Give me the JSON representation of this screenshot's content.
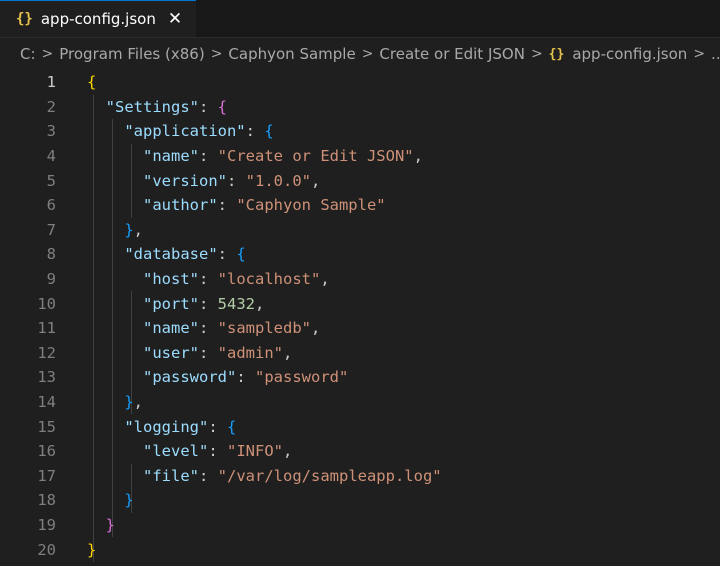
{
  "tab": {
    "icon": "json-braces-icon",
    "title": "app-config.json",
    "close": "✕"
  },
  "breadcrumb": {
    "items": [
      "C:",
      "Program Files (x86)",
      "Caphyon Sample",
      "Create or Edit JSON"
    ],
    "file_icon": "{}",
    "file": "app-config.json",
    "more": "..."
  },
  "editor": {
    "active_line": 1,
    "lines": [
      {
        "n": "1",
        "indent": "",
        "tokens": [
          [
            "b1",
            "{"
          ]
        ]
      },
      {
        "n": "2",
        "indent": "  ",
        "tokens": [
          [
            "k",
            "\"Settings\""
          ],
          [
            "p",
            ": "
          ],
          [
            "b2",
            "{"
          ]
        ]
      },
      {
        "n": "3",
        "indent": "    ",
        "tokens": [
          [
            "k",
            "\"application\""
          ],
          [
            "p",
            ": "
          ],
          [
            "b3",
            "{"
          ]
        ]
      },
      {
        "n": "4",
        "indent": "      ",
        "tokens": [
          [
            "k",
            "\"name\""
          ],
          [
            "p",
            ": "
          ],
          [
            "s",
            "\"Create or Edit JSON\""
          ],
          [
            "p",
            ","
          ]
        ]
      },
      {
        "n": "5",
        "indent": "      ",
        "tokens": [
          [
            "k",
            "\"version\""
          ],
          [
            "p",
            ": "
          ],
          [
            "s",
            "\"1.0.0\""
          ],
          [
            "p",
            ","
          ]
        ]
      },
      {
        "n": "6",
        "indent": "      ",
        "tokens": [
          [
            "k",
            "\"author\""
          ],
          [
            "p",
            ": "
          ],
          [
            "s",
            "\"Caphyon Sample\""
          ]
        ]
      },
      {
        "n": "7",
        "indent": "    ",
        "tokens": [
          [
            "b3",
            "}"
          ],
          [
            "p",
            ","
          ]
        ]
      },
      {
        "n": "8",
        "indent": "    ",
        "tokens": [
          [
            "k",
            "\"database\""
          ],
          [
            "p",
            ": "
          ],
          [
            "b3",
            "{"
          ]
        ]
      },
      {
        "n": "9",
        "indent": "      ",
        "tokens": [
          [
            "k",
            "\"host\""
          ],
          [
            "p",
            ": "
          ],
          [
            "s",
            "\"localhost\""
          ],
          [
            "p",
            ","
          ]
        ]
      },
      {
        "n": "10",
        "indent": "      ",
        "tokens": [
          [
            "k",
            "\"port\""
          ],
          [
            "p",
            ": "
          ],
          [
            "n",
            "5432"
          ],
          [
            "p",
            ","
          ]
        ]
      },
      {
        "n": "11",
        "indent": "      ",
        "tokens": [
          [
            "k",
            "\"name\""
          ],
          [
            "p",
            ": "
          ],
          [
            "s",
            "\"sampledb\""
          ],
          [
            "p",
            ","
          ]
        ]
      },
      {
        "n": "12",
        "indent": "      ",
        "tokens": [
          [
            "k",
            "\"user\""
          ],
          [
            "p",
            ": "
          ],
          [
            "s",
            "\"admin\""
          ],
          [
            "p",
            ","
          ]
        ]
      },
      {
        "n": "13",
        "indent": "      ",
        "tokens": [
          [
            "k",
            "\"password\""
          ],
          [
            "p",
            ": "
          ],
          [
            "s",
            "\"password\""
          ]
        ]
      },
      {
        "n": "14",
        "indent": "    ",
        "tokens": [
          [
            "b3",
            "}"
          ],
          [
            "p",
            ","
          ]
        ]
      },
      {
        "n": "15",
        "indent": "    ",
        "tokens": [
          [
            "k",
            "\"logging\""
          ],
          [
            "p",
            ": "
          ],
          [
            "b3",
            "{"
          ]
        ]
      },
      {
        "n": "16",
        "indent": "      ",
        "tokens": [
          [
            "k",
            "\"level\""
          ],
          [
            "p",
            ": "
          ],
          [
            "s",
            "\"INFO\""
          ],
          [
            "p",
            ","
          ]
        ]
      },
      {
        "n": "17",
        "indent": "      ",
        "tokens": [
          [
            "k",
            "\"file\""
          ],
          [
            "p",
            ": "
          ],
          [
            "s",
            "\"/var/log/sampleapp.log\""
          ]
        ]
      },
      {
        "n": "18",
        "indent": "    ",
        "tokens": [
          [
            "b3",
            "}"
          ]
        ]
      },
      {
        "n": "19",
        "indent": "  ",
        "tokens": [
          [
            "b2",
            "}"
          ]
        ]
      },
      {
        "n": "20",
        "indent": "",
        "tokens": [
          [
            "b1",
            "}"
          ]
        ]
      }
    ]
  }
}
